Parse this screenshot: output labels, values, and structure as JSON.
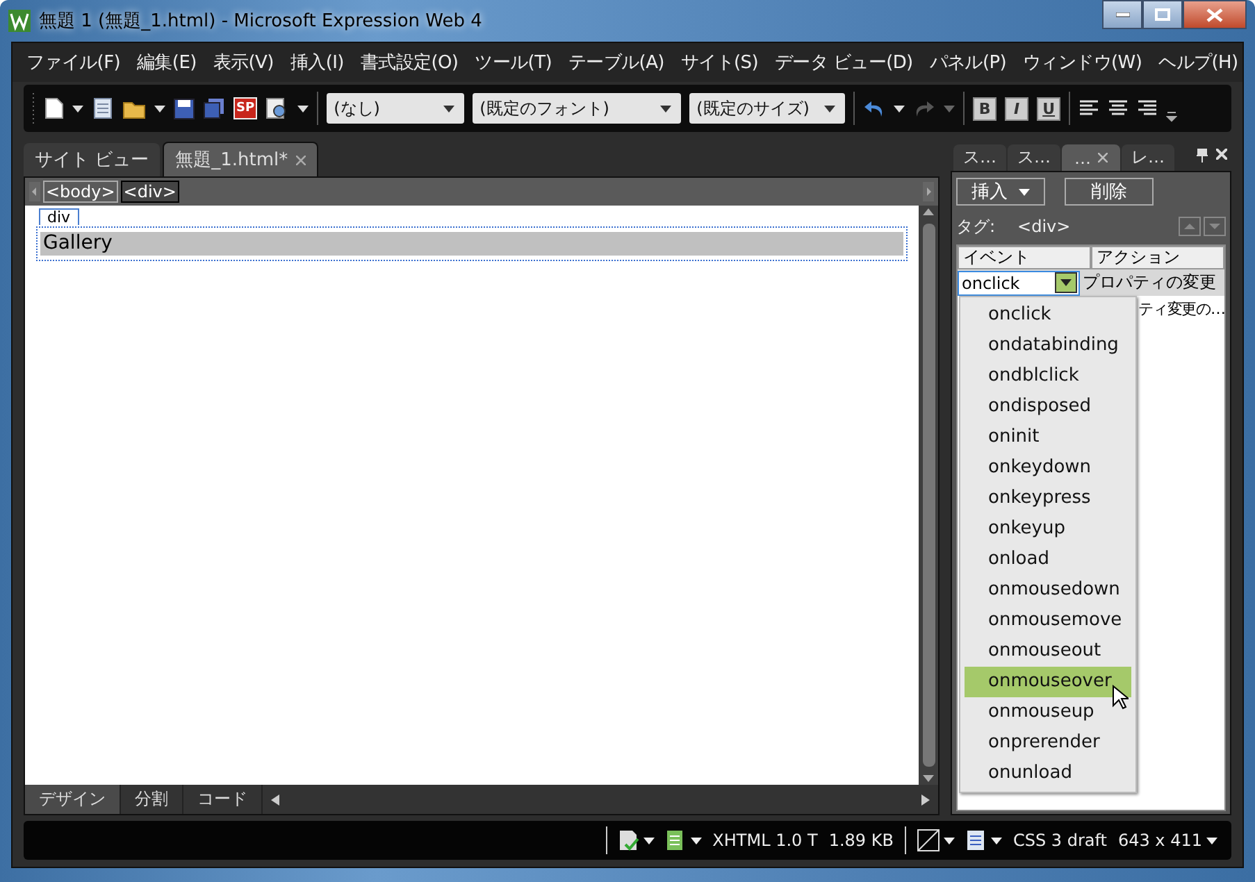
{
  "window": {
    "title": "無題 1 (無題_1.html) - Microsoft Expression Web 4"
  },
  "menu": [
    "ファイル(F)",
    "編集(E)",
    "表示(V)",
    "挿入(I)",
    "書式設定(O)",
    "ツール(T)",
    "テーブル(A)",
    "サイト(S)",
    "データ ビュー(D)",
    "パネル(P)",
    "ウィンドウ(W)",
    "ヘルプ(H)"
  ],
  "toolbar": {
    "publish_badge": "SP",
    "style": "(なし)",
    "font": "(既定のフォント)",
    "size": "(既定のサイズ)",
    "format_buttons": [
      "B",
      "I",
      "U"
    ]
  },
  "document_tabs": [
    {
      "label": "サイト ビュー",
      "selected": false
    },
    {
      "label": "無題_1.html*",
      "selected": true
    }
  ],
  "breadcrumb": [
    {
      "label": "<body>",
      "selected": false
    },
    {
      "label": "<div>",
      "selected": true
    }
  ],
  "page": {
    "tag_label": "div",
    "text": "Gallery"
  },
  "view_tabs": [
    {
      "label": "デザイン",
      "selected": true
    },
    {
      "label": "分割",
      "selected": false
    },
    {
      "label": "コード",
      "selected": false
    }
  ],
  "panel": {
    "tabs": [
      {
        "label": "ス…",
        "selected": false
      },
      {
        "label": "ス…",
        "selected": false
      },
      {
        "label": "…",
        "selected": true
      },
      {
        "label": "レ…",
        "selected": false
      }
    ],
    "insert_button": "挿入",
    "delete_button": "削除",
    "tag_label": "タグ:",
    "tag_value": "<div>",
    "columns": [
      "イベント",
      "アクション"
    ],
    "rows": [
      {
        "event": "onclick",
        "action": "プロパティの変更"
      },
      {
        "action": "ティ変更の…"
      }
    ],
    "event_options": [
      {
        "label": "onclick",
        "selected": false
      },
      {
        "label": "ondatabinding",
        "selected": false
      },
      {
        "label": "ondblclick",
        "selected": false
      },
      {
        "label": "ondisposed",
        "selected": false
      },
      {
        "label": "oninit",
        "selected": false
      },
      {
        "label": "onkeydown",
        "selected": false
      },
      {
        "label": "onkeypress",
        "selected": false
      },
      {
        "label": "onkeyup",
        "selected": false
      },
      {
        "label": "onload",
        "selected": false
      },
      {
        "label": "onmousedown",
        "selected": false
      },
      {
        "label": "onmousemove",
        "selected": false
      },
      {
        "label": "onmouseout",
        "selected": false
      },
      {
        "label": "onmouseover",
        "selected": true
      },
      {
        "label": "onmouseup",
        "selected": false
      },
      {
        "label": "onprerender",
        "selected": false
      },
      {
        "label": "onunload",
        "selected": false
      }
    ]
  },
  "status_bar": {
    "doctype": "XHTML 1.0 T",
    "size": "1.89 KB",
    "css": "CSS 3 draft",
    "dimensions": "643 x 411"
  }
}
